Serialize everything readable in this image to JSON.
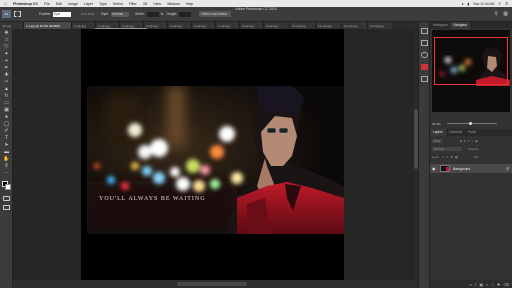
{
  "menubar": {
    "apple": "",
    "items": [
      "Photoshop CC",
      "File",
      "Edit",
      "Image",
      "Layer",
      "Type",
      "Select",
      "Filter",
      "3D",
      "View",
      "Window",
      "Help"
    ],
    "right": [
      "Sun 11:34 AM"
    ]
  },
  "optbar": {
    "tool_preset": "Feather",
    "feather_value": "0 px",
    "anti_alias": "Anti-alias",
    "style_label": "Style:",
    "style_value": "Normal",
    "width_label": "Width:",
    "height_label": "Height:",
    "mask_button": "Select and Mask..."
  },
  "app_title": "Adobe Photoshop CC 2015",
  "tabs": [
    "rgb.jpg",
    "x-1.jpg @ 93.3% (RGB/8)",
    "1-rgb.jpg",
    "2-rgb.jpg",
    "3-rgb.jpg",
    "4-rgb.jpg",
    "5-rgb.jpg",
    "6-rgb.jpg",
    "7-rgb.jpg",
    "8-rgb.jpg",
    "9-rgb.jpg",
    "10-rgb.jpg",
    "11-rgb.jpg",
    "12-rgb.jpg",
    "13-rgb.jpg"
  ],
  "tooltip": "x-1.jpg @ 93.3% (Layer 1, RGB/8)",
  "photo_caption": "YOU'LL ALWAYS BE WAITING",
  "tools": [
    "move-icon",
    "marquee-icon",
    "lasso-icon",
    "quick-select-icon",
    "crop-icon",
    "eyedropper-icon",
    "healing-icon",
    "brush-icon",
    "stamp-icon",
    "history-brush-icon",
    "eraser-icon",
    "gradient-icon",
    "blur-icon",
    "dodge-icon",
    "pen-icon",
    "type-icon",
    "path-select-icon",
    "shape-icon",
    "hand-icon",
    "zoom-icon",
    "more-icon"
  ],
  "panel": {
    "tabs_top": [
      "Histogram",
      "Navigator"
    ],
    "zoom": "93.3%",
    "tabs_layers": [
      "Layers",
      "Channels",
      "Paths"
    ],
    "kind": "Kind",
    "blend": "Normal",
    "opacity_label": "Opacity:",
    "lock_label": "Lock:",
    "fill_label": "Fill:",
    "layer_name": "Background"
  },
  "colors": {
    "accent_red": "#e23a3a",
    "menubar_bg": "#e9e9e9",
    "ui_dark": "#3c3c3c"
  }
}
